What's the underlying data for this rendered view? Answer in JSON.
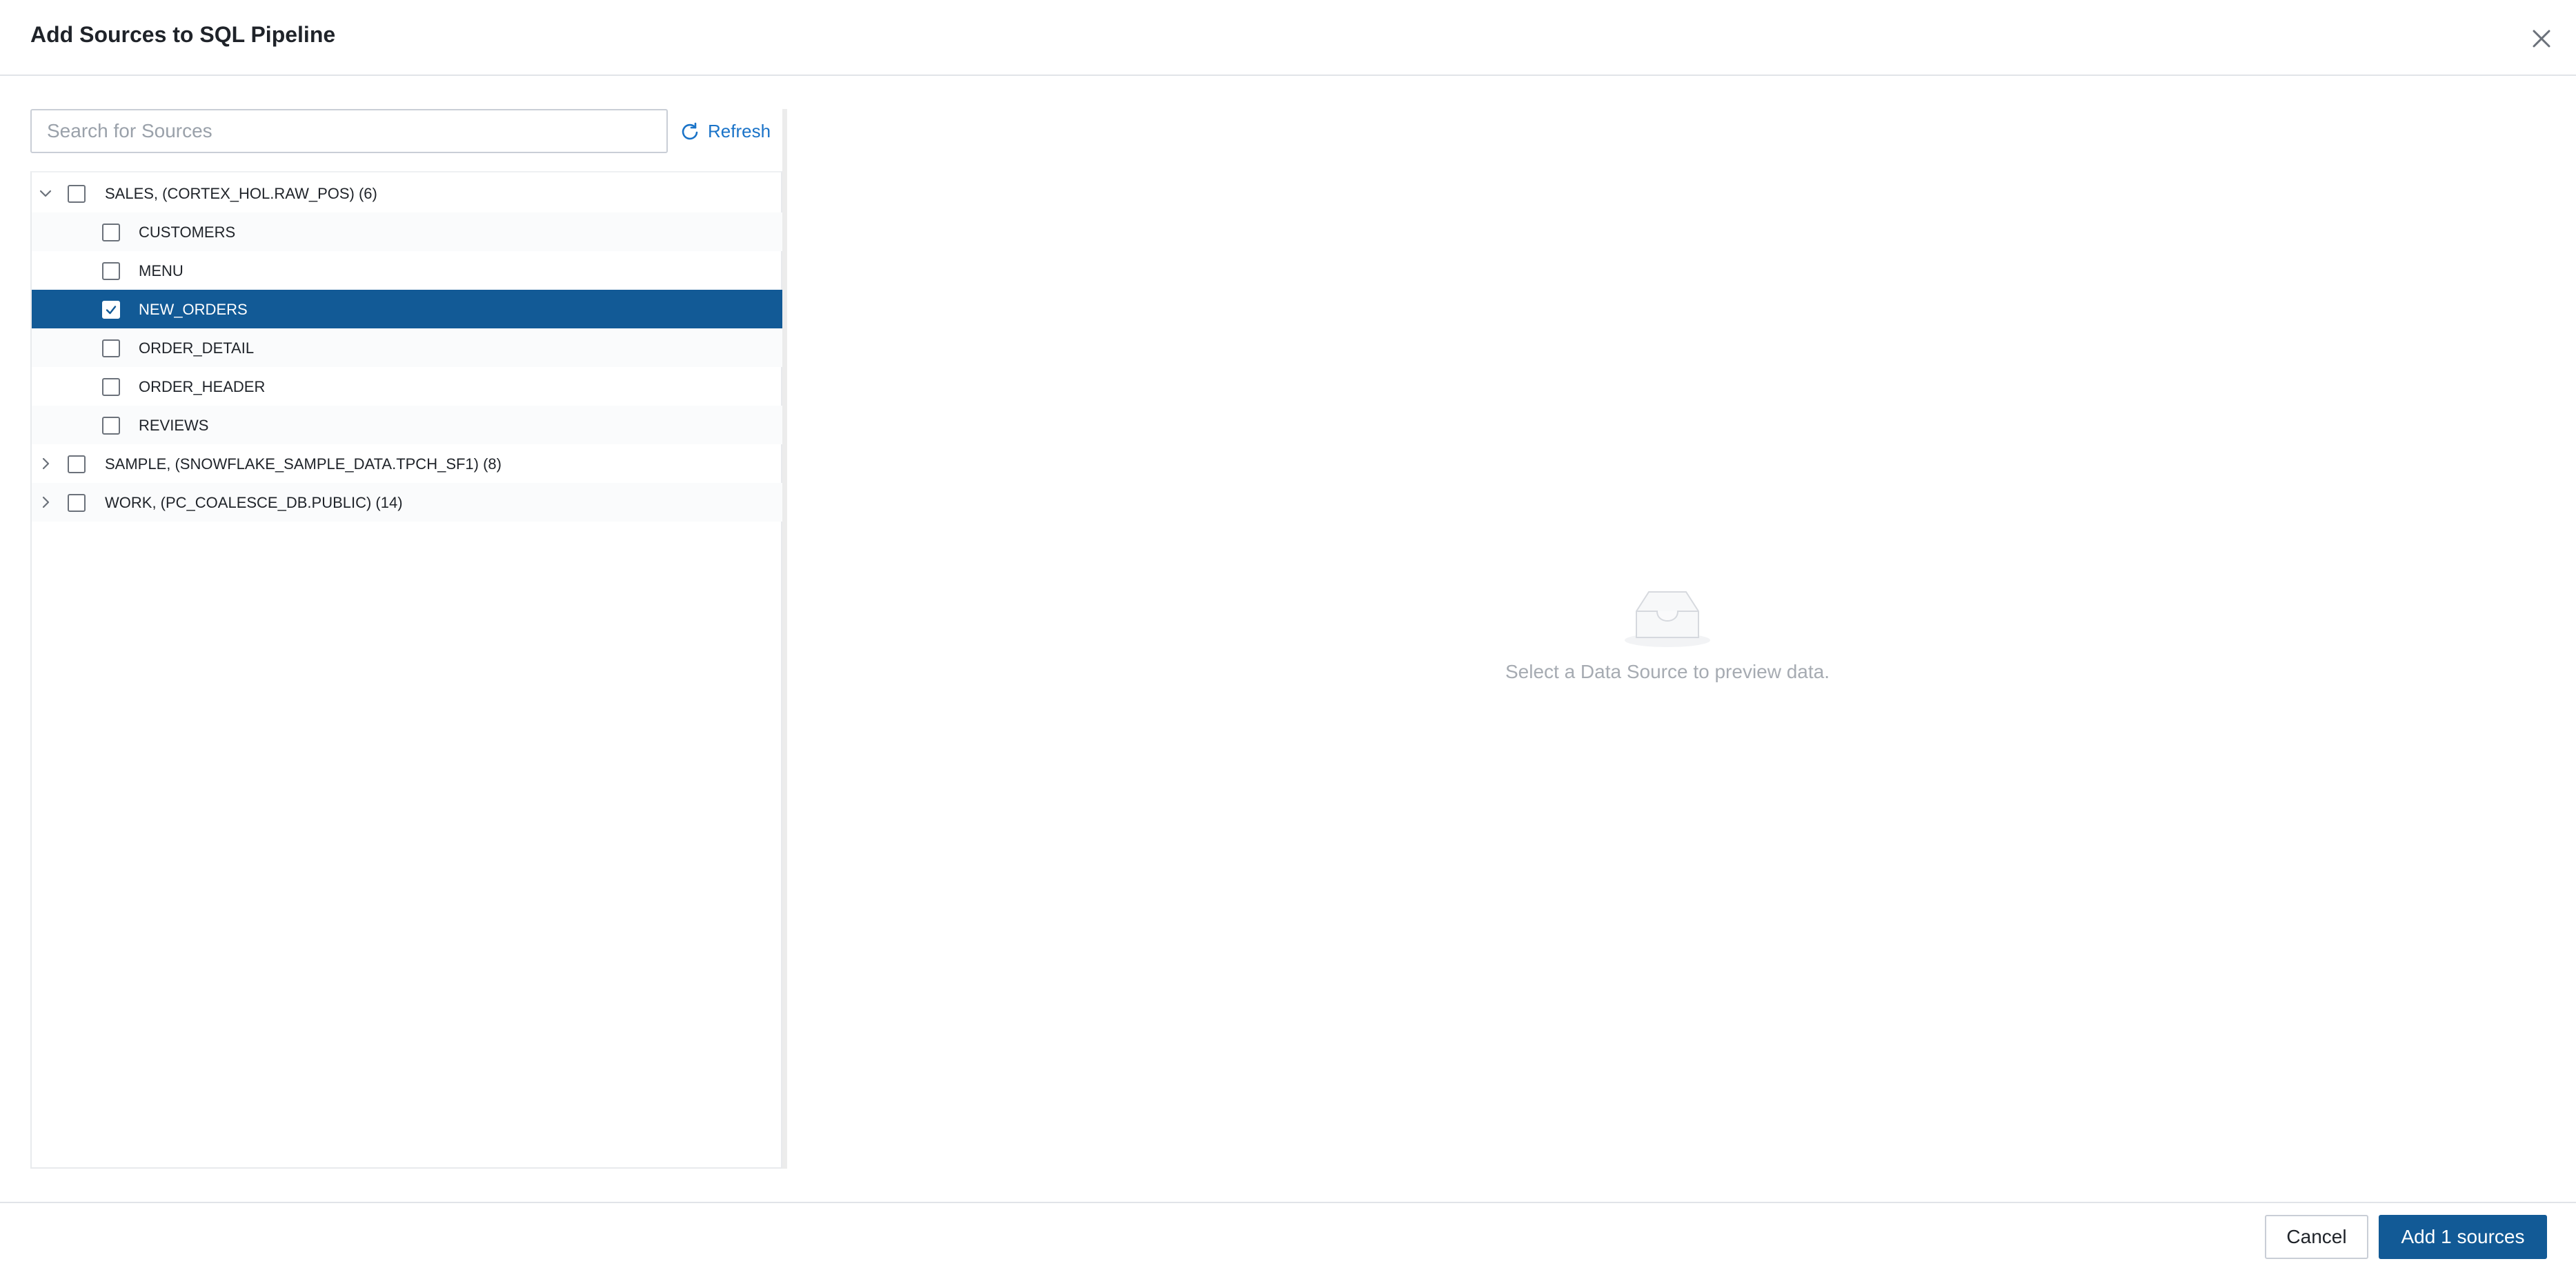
{
  "dialog": {
    "title": "Add Sources to SQL Pipeline",
    "close_icon": "close-icon"
  },
  "search": {
    "placeholder": "Search for Sources",
    "value": "",
    "refresh_label": "Refresh",
    "refresh_icon": "refresh-icon"
  },
  "tree": {
    "groups": [
      {
        "label": "SALES, (CORTEX_HOL.RAW_POS) (6)",
        "expanded": true,
        "checked": false,
        "children": [
          {
            "label": "CUSTOMERS",
            "checked": false,
            "selected": false
          },
          {
            "label": "MENU",
            "checked": false,
            "selected": false
          },
          {
            "label": "NEW_ORDERS",
            "checked": true,
            "selected": true
          },
          {
            "label": "ORDER_DETAIL",
            "checked": false,
            "selected": false
          },
          {
            "label": "ORDER_HEADER",
            "checked": false,
            "selected": false
          },
          {
            "label": "REVIEWS",
            "checked": false,
            "selected": false
          }
        ]
      },
      {
        "label": "SAMPLE, (SNOWFLAKE_SAMPLE_DATA.TPCH_SF1) (8)",
        "expanded": false,
        "checked": false
      },
      {
        "label": "WORK, (PC_COALESCE_DB.PUBLIC) (14)",
        "expanded": false,
        "checked": false
      }
    ]
  },
  "preview": {
    "empty_icon": "empty-inbox-icon",
    "empty_text": "Select a Data Source to preview data."
  },
  "footer": {
    "cancel_label": "Cancel",
    "add_label": "Add 1 sources"
  },
  "colors": {
    "accent": "#125a96",
    "link": "#1a73c8",
    "muted_text": "#a6abb2"
  }
}
